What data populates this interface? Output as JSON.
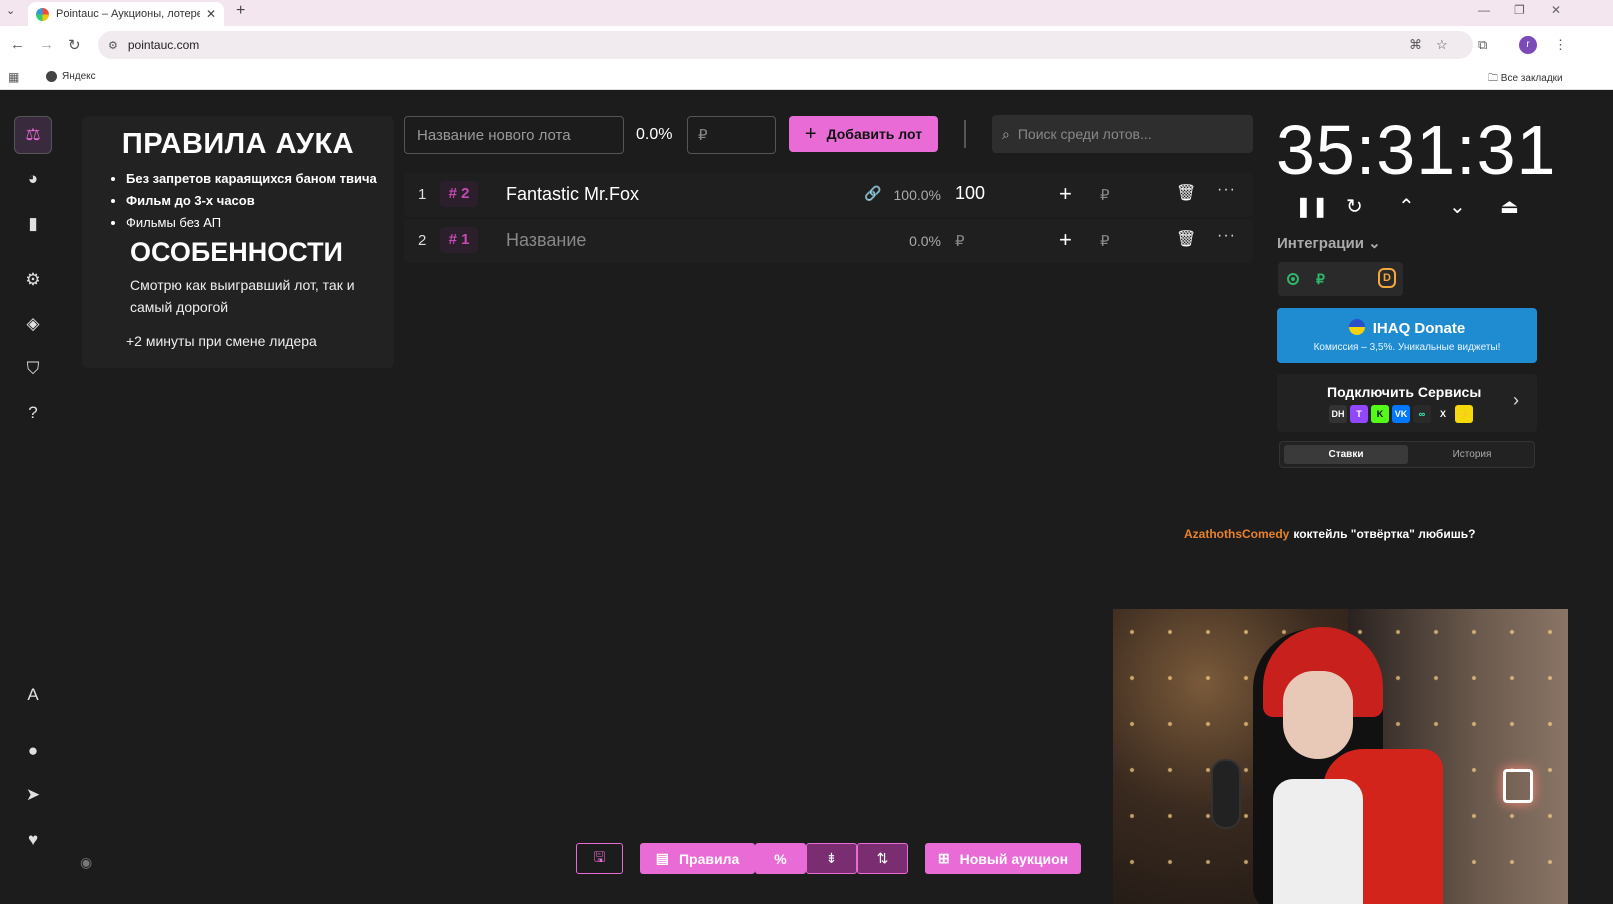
{
  "browser": {
    "tab_title": "Pointauc – Аукционы, лотереи",
    "tab_close": "✕",
    "new_tab": "+",
    "url": "pointauc.com",
    "bookmark_yandex": "Яндекс",
    "bookmark_all": "Все закладки",
    "profile_initial": "r"
  },
  "rules": {
    "title": "ПРАВИЛА АУКА",
    "items": [
      "Без запретов караящихся баном твича",
      "Фильм до 3-х часов",
      "Фильмы без АП"
    ],
    "features_title": "ОСОБЕННОСТИ",
    "features_text": "Смотрю как выигравший лот, так и самый дорогой",
    "extra": "+2 минуты при смене лидера"
  },
  "toolbar": {
    "lot_placeholder": "Название нового лота",
    "percent": "0.0%",
    "amount_placeholder": "₽",
    "add_label": "Добавить лот",
    "search_placeholder": "Поиск среди лотов..."
  },
  "lots": [
    {
      "index": "1",
      "tag": "# 2",
      "name": "Fantastic Mr.Fox",
      "percent": "100.0%",
      "amount": "100",
      "currency": "₽"
    },
    {
      "index": "2",
      "tag": "# 1",
      "name": "Название",
      "percent": "0.0%",
      "amount": "₽",
      "currency": "₽"
    }
  ],
  "timer": {
    "value": "35:31:31"
  },
  "integrations": {
    "label": "Интеграции",
    "ruble": "₽",
    "da": "D"
  },
  "donate": {
    "title": "IHAQ Donate",
    "subtitle": "Комиссия – 3,5%. Уникальные виджеты!"
  },
  "services": {
    "title": "Подключить Сервисы",
    "icons": [
      "DH",
      "T",
      "K",
      "VK",
      "∞",
      "X",
      "⚡"
    ]
  },
  "history_tabs": {
    "bets": "Ставки",
    "history": "История"
  },
  "chat": {
    "user": "AzathothsComedy",
    "message": "коктейль \"отвёртка\" любишь?"
  },
  "bottom": {
    "rules_label": "Правила",
    "percent_icon": "%",
    "new_auction_label": "Новый аукцион"
  },
  "colors": {
    "accent": "#e86bd6",
    "background": "#1c1c1c",
    "donate_blue": "#1f8cd1",
    "chat_user": "#e8822a"
  }
}
